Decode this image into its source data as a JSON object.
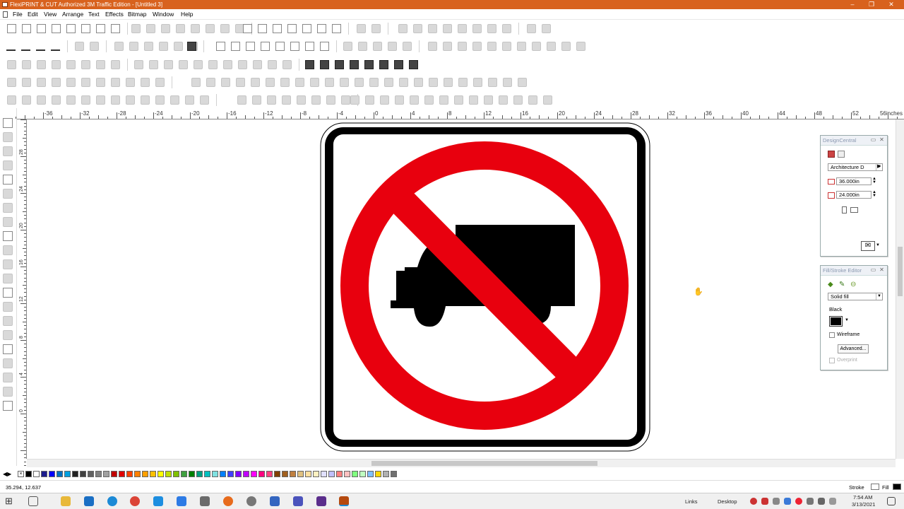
{
  "window": {
    "title": "FlexiPRINT & CUT Authorized 3M Traffic Edition - [Untitled 3]",
    "minimize": "–",
    "restore": "❐",
    "close": "✕"
  },
  "menu": [
    "File",
    "Edit",
    "View",
    "Arrange",
    "Text",
    "Effects",
    "Bitmap",
    "Window",
    "Help"
  ],
  "ruler": {
    "unit_label": "56inches",
    "labels": [
      "-36",
      "-32",
      "-28",
      "-24",
      "-20",
      "-16",
      "-12",
      "-8",
      "-4",
      "0",
      "4",
      "8",
      "12",
      "16",
      "20",
      "24",
      "28",
      "32",
      "36",
      "40",
      "44",
      "48",
      "52"
    ]
  },
  "vruler": {
    "labels": [
      "28",
      "24",
      "20",
      "16",
      "12",
      "8",
      "4",
      "0"
    ]
  },
  "design_central": {
    "title": "DesignCentral",
    "paper_size": "Architecture D",
    "width": "36.000in",
    "height": "24.000in"
  },
  "fill_stroke": {
    "title": "Fill/Stroke Editor",
    "fill_type": "Solid fill",
    "color_name": "Black",
    "color": "#000000",
    "wireframe_label": "Wireframe",
    "advanced_label": "Advanced...",
    "overprint_label": "Overprint"
  },
  "sign": {
    "ring_color": "#e8000e",
    "border_color": "#000000",
    "background": "#ffffff",
    "truck_color": "#000000"
  },
  "status": {
    "coords": "35.294,  12.637",
    "stroke_label": "Stroke",
    "fill_label": "Fill"
  },
  "taskbar": {
    "links": "Links",
    "desktop": "Desktop",
    "time": "7:54 AM",
    "date": "3/13/2021"
  },
  "palette": [
    "#000000",
    "#ffffff",
    "#1c1c8c",
    "#0000ff",
    "#0070c0",
    "#00a0e0",
    "#202020",
    "#404040",
    "#606060",
    "#808080",
    "#a0a0a0",
    "#c00000",
    "#e00000",
    "#ff4000",
    "#ff8000",
    "#ffa000",
    "#ffc000",
    "#ffff00",
    "#c0e000",
    "#80c000",
    "#40a040",
    "#008000",
    "#00a080",
    "#00c0c0",
    "#80e0e0",
    "#0080ff",
    "#4040ff",
    "#8000ff",
    "#c000ff",
    "#ff00ff",
    "#ff0080",
    "#ff4080",
    "#804000",
    "#a06020",
    "#c08040",
    "#e0c080",
    "#ffe0a0",
    "#fff0c0",
    "#e0e0ff",
    "#c0c0ff",
    "#ff8080",
    "#ffc0c0",
    "#80ff80",
    "#c0ffc0",
    "#80c0ff",
    "#ffd700",
    "#b0b0b0",
    "#707070"
  ]
}
